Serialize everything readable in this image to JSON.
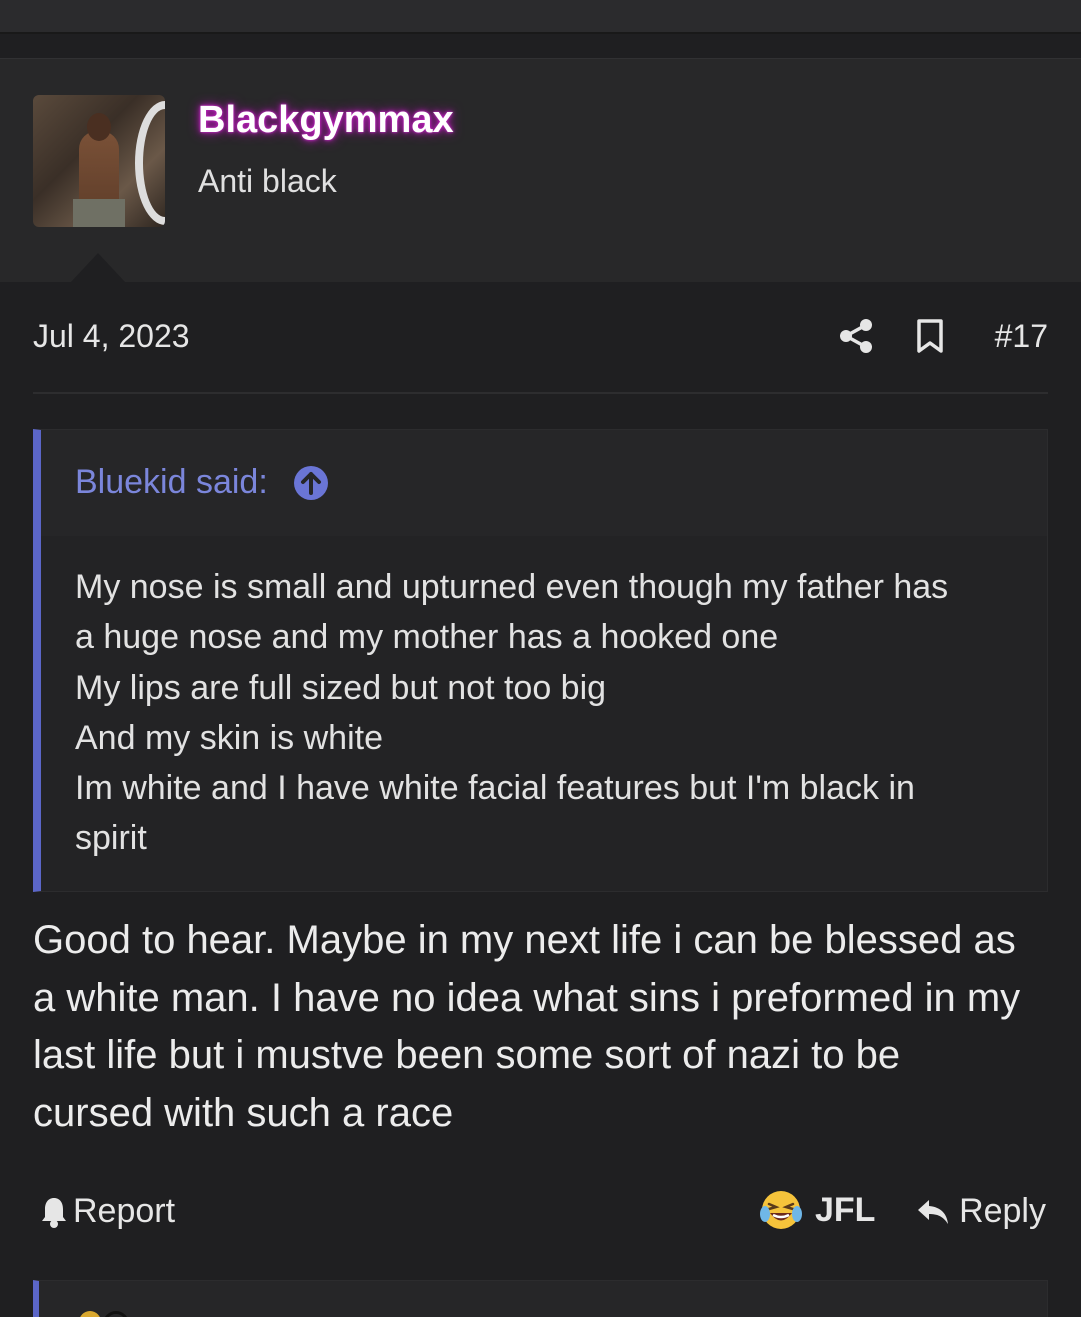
{
  "user": {
    "username": "Blackgymmax",
    "title": "Anti black",
    "avatar_icon": "user-avatar-photo"
  },
  "post": {
    "date": "Jul 4, 2023",
    "number": "#17",
    "quote": {
      "author": "Bluekid said:",
      "lines": [
        "My nose is small and upturned even though my father has",
        "a huge nose and my mother has a hooked one",
        "My lips are full sized but not too big",
        "And my skin is white",
        "Im white and I have white facial features but I'm black in",
        "spirit"
      ]
    },
    "message_lines": [
      "Good to hear. Maybe in my next life i can be blessed as",
      "a white man. I have no idea what sins i preformed in my",
      "last life but i mustve been some sort of nazi to be",
      "cursed with such a race"
    ]
  },
  "actions": {
    "report_label": "Report",
    "reaction_label": "JFL",
    "reply_label": "Reply"
  },
  "colors": {
    "quote_accent": "#5b66c8",
    "quote_author": "#7b86db",
    "username_glow": "#c020c0",
    "background": "#1f1f21"
  }
}
